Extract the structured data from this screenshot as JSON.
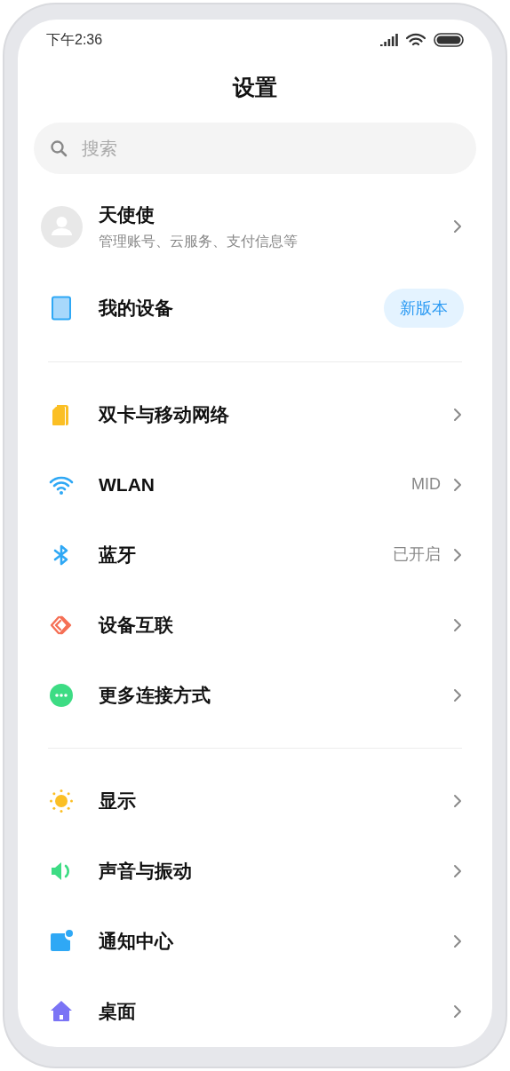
{
  "status_bar": {
    "time": "下午2:36"
  },
  "title": "设置",
  "search": {
    "placeholder": "搜索"
  },
  "account": {
    "name": "天使使",
    "subtitle": "管理账号、云服务、支付信息等"
  },
  "device": {
    "label": "我的设备",
    "badge": "新版本"
  },
  "sections": [
    {
      "items": [
        {
          "kind": "sim",
          "label": "双卡与移动网络"
        },
        {
          "kind": "wifi",
          "label": "WLAN",
          "value": "MID"
        },
        {
          "kind": "bluetooth",
          "label": "蓝牙",
          "value": "已开启"
        },
        {
          "kind": "link",
          "label": "设备互联"
        },
        {
          "kind": "more",
          "label": "更多连接方式"
        }
      ]
    },
    {
      "items": [
        {
          "kind": "display",
          "label": "显示"
        },
        {
          "kind": "sound",
          "label": "声音与振动"
        },
        {
          "kind": "notification",
          "label": "通知中心"
        },
        {
          "kind": "home",
          "label": "桌面"
        }
      ]
    }
  ]
}
